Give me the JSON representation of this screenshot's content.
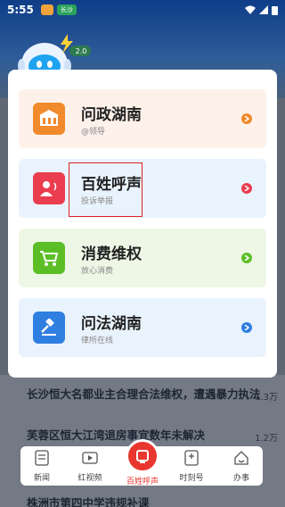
{
  "status_bar": {
    "time": "5:55",
    "app_badge": "长沙"
  },
  "mascot": {
    "badge": "2.0"
  },
  "menu": [
    {
      "title": "问政湖南",
      "subtitle": "@领导",
      "bg": "#fdf1ea",
      "icon_bg": "#f08a2c",
      "arrow": "#f08a2c",
      "icon": "building-icon"
    },
    {
      "title": "百姓呼声",
      "subtitle": "投诉举报",
      "bg": "#e9f3fd",
      "icon_bg": "#ea3d4f",
      "arrow": "#ea3d4f",
      "icon": "speaker-person-icon"
    },
    {
      "title": "消费维权",
      "subtitle": "放心消费",
      "bg": "#eef6e6",
      "icon_bg": "#5cbe27",
      "arrow": "#5cbe27",
      "icon": "cart-icon"
    },
    {
      "title": "问法湖南",
      "subtitle": "律所在线",
      "bg": "#e9f3fd",
      "icon_bg": "#2f7fe0",
      "arrow": "#2f7fe0",
      "icon": "gavel-icon"
    }
  ],
  "news": [
    {
      "title": "长沙恒大名都业主合理合法维权，遭遇暴力执法",
      "views": "1.3万"
    },
    {
      "title": "芙蓉区恒大江湾退房事宜数年未解决",
      "views": "1.2万"
    },
    {
      "title": "株洲市第四中学违规补课"
    }
  ],
  "tabs": [
    {
      "label": "新闻",
      "icon": "news-icon"
    },
    {
      "label": "红视频",
      "icon": "video-icon"
    },
    {
      "label": "百姓呼声",
      "icon": "voice-icon",
      "active": true
    },
    {
      "label": "时刻号",
      "icon": "bookmark-icon"
    },
    {
      "label": "办事",
      "icon": "home-icon"
    }
  ]
}
